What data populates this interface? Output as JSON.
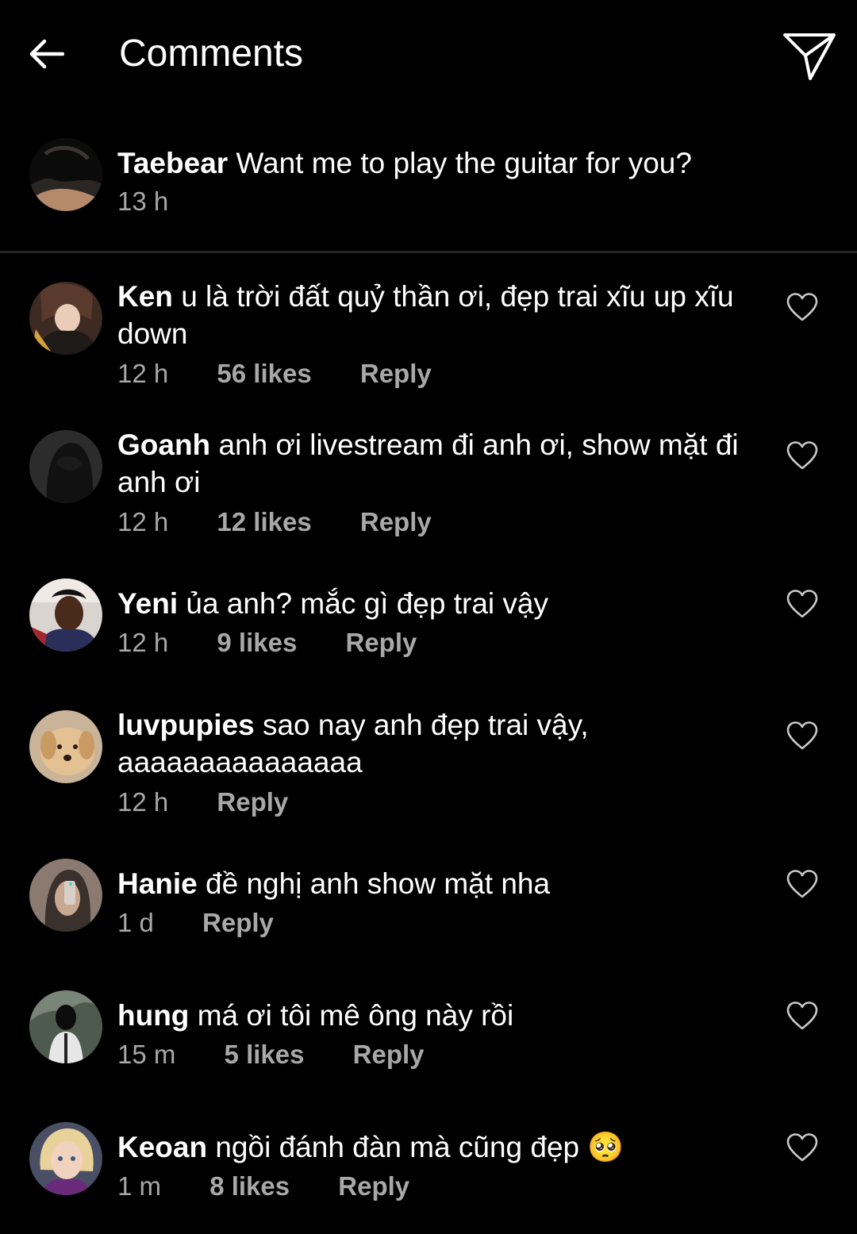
{
  "header": {
    "title": "Comments"
  },
  "caption": {
    "username": "Taebear",
    "text": "Want me to play the guitar for you?",
    "time": "13 h"
  },
  "comments": [
    {
      "username": "Ken",
      "text": "u là trời đất quỷ thần ơi, đẹp trai xĩu up xĩu down",
      "time": "12 h",
      "likes": "56 likes",
      "reply": "Reply"
    },
    {
      "username": "Goanh",
      "text": "anh ơi livestream đi anh ơi, show mặt đi anh ơi",
      "time": "12 h",
      "likes": "12 likes",
      "reply": "Reply"
    },
    {
      "username": "Yeni",
      "text": "ủa anh? mắc gì đẹp trai vậy",
      "time": "12 h",
      "likes": "9 likes",
      "reply": "Reply"
    },
    {
      "username": "luvpupies",
      "text": "sao nay anh đẹp trai vậy, aaaaaaaaaaaaaaa",
      "time": "12 h",
      "likes": "",
      "reply": "Reply"
    },
    {
      "username": "Hanie",
      "text": "đề nghị anh show mặt nha",
      "time": "1 d",
      "likes": "",
      "reply": "Reply"
    },
    {
      "username": "hung",
      "text": "má ơi tôi mê ông này rồi",
      "time": "15 m",
      "likes": "5 likes",
      "reply": "Reply"
    },
    {
      "username": "Keoan",
      "text": "ngồi đánh đàn mà cũng đẹp 🥺",
      "time": "1 m",
      "likes": "8 likes",
      "reply": "Reply"
    }
  ],
  "icons": {
    "back": "arrow-left-icon",
    "send": "paper-plane-icon",
    "like": "heart-outline-icon"
  },
  "colors": {
    "background": "#000000",
    "text": "#ffffff",
    "meta_text": "#a8a8a8",
    "divider": "#262626"
  }
}
